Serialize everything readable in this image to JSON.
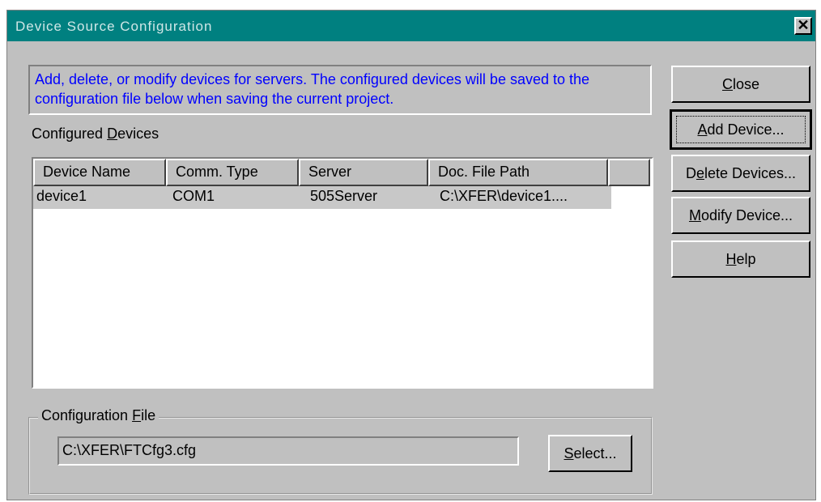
{
  "window": {
    "title": "Device Source Configuration",
    "close_glyph": "✕"
  },
  "info_text": "Add, delete, or modify devices for servers.  The configured devices will be saved to the configuration file below when saving the current project.",
  "devices_label": {
    "pre": "Configured ",
    "mnemonic": "D",
    "post": "evices"
  },
  "table": {
    "columns": [
      "Device Name",
      "Comm. Type",
      "Server",
      "Doc. File Path"
    ],
    "rows": [
      {
        "device_name": "device1",
        "comm_type": "COM1",
        "server": "505Server",
        "doc_path": "C:\\XFER\\device1...."
      }
    ]
  },
  "buttons": {
    "close": {
      "pre": "",
      "mnemonic": "C",
      "post": "lose"
    },
    "add": {
      "pre": "",
      "mnemonic": "A",
      "post": "dd Device..."
    },
    "delete": {
      "pre": "D",
      "mnemonic": "e",
      "post": "lete Devices..."
    },
    "modify": {
      "pre": "",
      "mnemonic": "M",
      "post": "odify Device..."
    },
    "help": {
      "pre": "",
      "mnemonic": "H",
      "post": "elp"
    },
    "select": {
      "pre": "",
      "mnemonic": "S",
      "post": "elect..."
    }
  },
  "config_file": {
    "label": {
      "pre": "Configuration ",
      "mnemonic": "F",
      "post": "ile"
    },
    "path": "C:\\XFER\\FTCfg3.cfg"
  }
}
